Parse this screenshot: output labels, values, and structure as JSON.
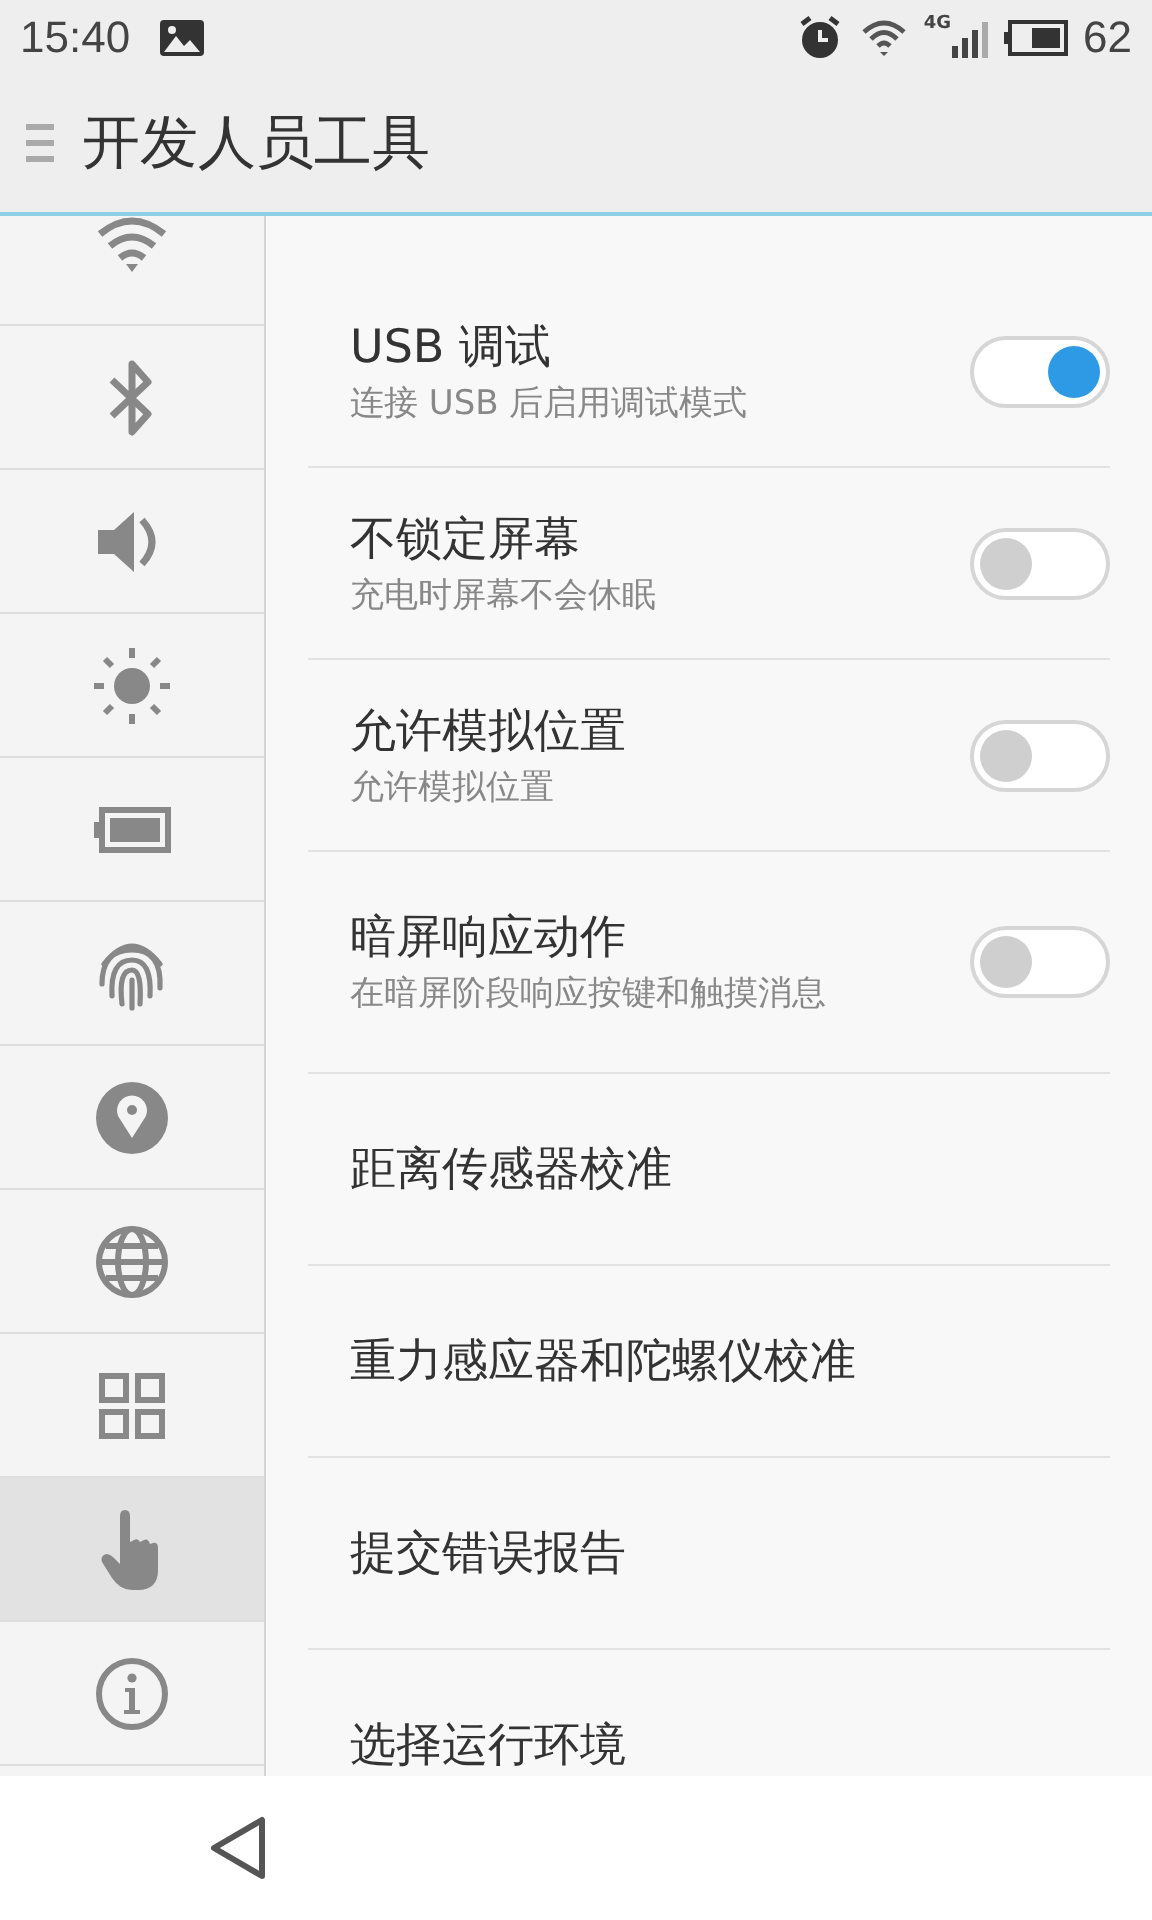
{
  "status_bar": {
    "time": "15:40",
    "network": "4G",
    "battery": "62"
  },
  "header": {
    "title": "开发人员工具"
  },
  "sidebar": {
    "items": [
      {
        "kind": "wifi",
        "selected": false
      },
      {
        "kind": "bluetooth",
        "selected": false
      },
      {
        "kind": "sound",
        "selected": false
      },
      {
        "kind": "brightness",
        "selected": false
      },
      {
        "kind": "battery",
        "selected": false
      },
      {
        "kind": "fingerprint",
        "selected": false
      },
      {
        "kind": "location",
        "selected": false
      },
      {
        "kind": "globe",
        "selected": false
      },
      {
        "kind": "apps",
        "selected": false
      },
      {
        "kind": "hand",
        "selected": true
      },
      {
        "kind": "info",
        "selected": false
      }
    ]
  },
  "settings": [
    {
      "title": "USB 调试",
      "subtitle": "连接 USB 后启用调试模式",
      "kind": "toggle",
      "on": true
    },
    {
      "title": "不锁定屏幕",
      "subtitle": "充电时屏幕不会休眠",
      "kind": "toggle",
      "on": false
    },
    {
      "title": "允许模拟位置",
      "subtitle": "允许模拟位置",
      "kind": "toggle",
      "on": false
    },
    {
      "title": "暗屏响应动作",
      "subtitle": "在暗屏阶段响应按键和触摸消息",
      "kind": "toggle",
      "on": false
    },
    {
      "title": "距离传感器校准",
      "kind": "link"
    },
    {
      "title": "重力感应器和陀螺仪校准",
      "kind": "link"
    },
    {
      "title": "提交错误报告",
      "kind": "link"
    },
    {
      "title": "选择运行环境",
      "kind": "link"
    }
  ]
}
